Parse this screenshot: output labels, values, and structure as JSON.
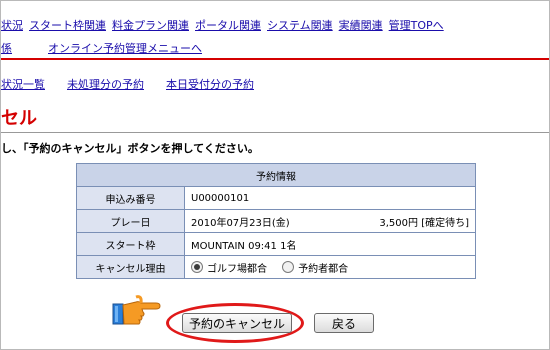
{
  "topnav": {
    "items": [
      "状況",
      "スタート枠関連",
      "料金プラン関連",
      "ポータル関連",
      "システム関連",
      "実績関連",
      "管理TOPへ"
    ]
  },
  "subnav": {
    "left": "係",
    "menu": "オンライン予約管理メニューへ"
  },
  "second_nav": {
    "items": [
      "状況一覧",
      "未処理分の予約",
      "本日受付分の予約"
    ]
  },
  "page": {
    "title": "セル",
    "instruction": "し、「予約のキャンセル」ボタンを押してください。"
  },
  "table": {
    "header": "予約情報",
    "rows": [
      {
        "label": "申込み番号",
        "value": "U00000101"
      },
      {
        "label": "プレー日",
        "value": "2010年07月23日(金)",
        "status": "3,500円 [確定待ち]"
      },
      {
        "label": "スタート枠",
        "value": "MOUNTAIN 09:41 1名"
      },
      {
        "label": "キャンセル理由",
        "options": [
          "ゴルフ場都合",
          "予約者都合"
        ],
        "selected": "ゴルフ場都合"
      }
    ]
  },
  "buttons": {
    "cancel_label": "予約のキャンセル",
    "back_label": "戻る"
  },
  "colors": {
    "accent_red": "#d40000",
    "link_blue": "#1a0dab",
    "table_head": "#c9d3e8",
    "table_label": "#dde3f1",
    "highlight": "#e01919"
  },
  "icons": {
    "pointer": "pointing-hand-icon"
  }
}
